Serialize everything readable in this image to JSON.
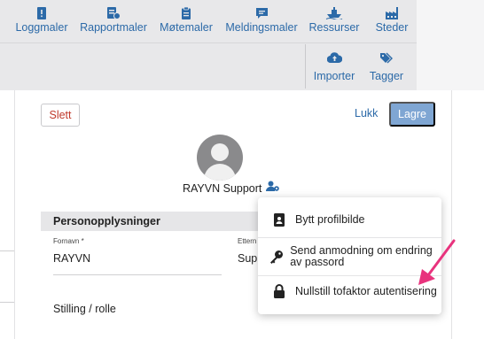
{
  "colors": {
    "accent": "#2c6aa8",
    "danger": "#c0392b",
    "save_bg": "#7fa6d3",
    "arrow": "#e8337d"
  },
  "nav": {
    "items": [
      {
        "label": "Loggmaler",
        "icon": "log-icon"
      },
      {
        "label": "Rapportmaler",
        "icon": "report-icon"
      },
      {
        "label": "Møtemaler",
        "icon": "clipboard-icon"
      },
      {
        "label": "Meldingsmaler",
        "icon": "message-icon"
      },
      {
        "label": "Ressurser",
        "icon": "ship-icon"
      },
      {
        "label": "Steder",
        "icon": "factory-icon"
      }
    ]
  },
  "toolbar": {
    "import_label": "Importer",
    "tags_label": "Tagger"
  },
  "actions": {
    "delete_label": "Slett",
    "close_label": "Lukk",
    "save_label": "Lagre"
  },
  "profile": {
    "name": "RAYVN Support"
  },
  "section": {
    "title": "Personopplysninger"
  },
  "fields": {
    "firstname_label": "Fornavn *",
    "firstname_value": "RAYVN",
    "lastname_label": "Ettern",
    "lastname_value": "Supp",
    "role_label": "Stilling / rolle"
  },
  "menu": {
    "items": [
      {
        "label": "Bytt profilbilde",
        "icon": "id-card-icon"
      },
      {
        "label": "Send anmodning om endring av passord",
        "icon": "key-icon"
      },
      {
        "label": "Nullstill tofaktor autentisering",
        "icon": "lock-icon"
      }
    ]
  }
}
